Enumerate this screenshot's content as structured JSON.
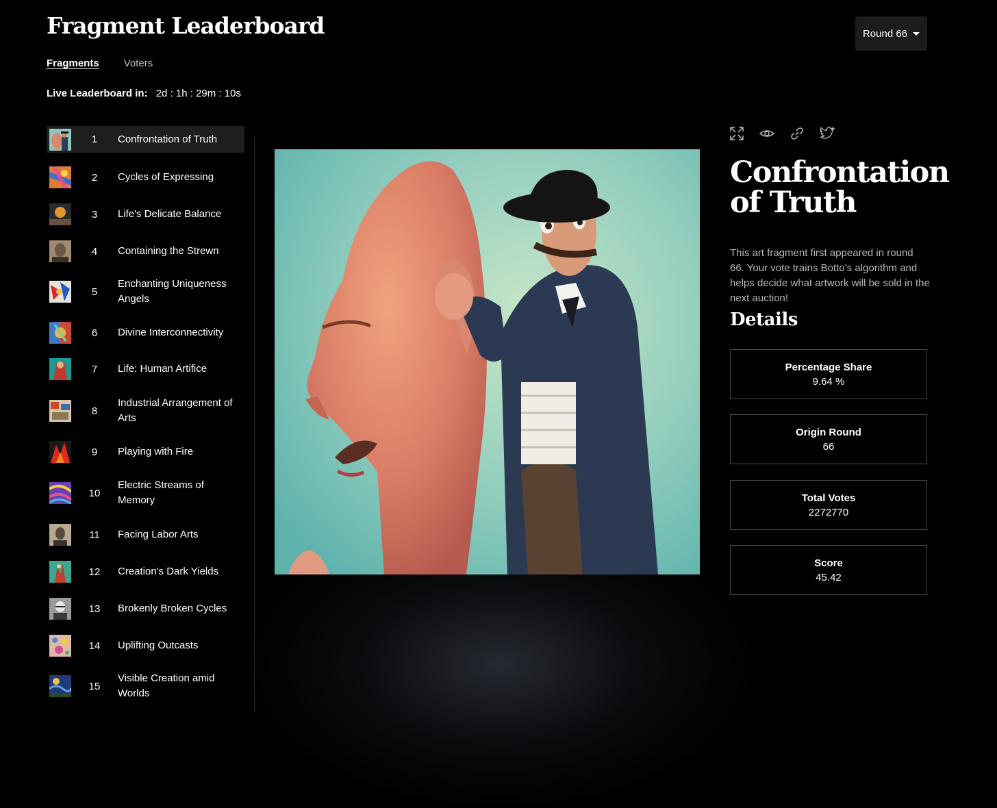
{
  "header": {
    "title": "Fragment Leaderboard",
    "round_label": "Round 66"
  },
  "tabs": [
    {
      "label": "Fragments",
      "active": true
    },
    {
      "label": "Voters",
      "active": false
    }
  ],
  "live": {
    "label": "Live Leaderboard in:",
    "countdown": "2d : 1h : 29m : 10s"
  },
  "leaderboard": [
    {
      "rank": "1",
      "name": "Confrontation of Truth",
      "active": true
    },
    {
      "rank": "2",
      "name": "Cycles of Expressing"
    },
    {
      "rank": "3",
      "name": "Life's Delicate Balance"
    },
    {
      "rank": "4",
      "name": "Containing the Strewn"
    },
    {
      "rank": "5",
      "name": "Enchanting Uniqueness Angels"
    },
    {
      "rank": "6",
      "name": "Divine Interconnectivity"
    },
    {
      "rank": "7",
      "name": "Life: Human Artifice"
    },
    {
      "rank": "8",
      "name": "Industrial Arrangement of Arts"
    },
    {
      "rank": "9",
      "name": "Playing with Fire"
    },
    {
      "rank": "10",
      "name": "Electric Streams of Memory"
    },
    {
      "rank": "11",
      "name": "Facing Labor Arts"
    },
    {
      "rank": "12",
      "name": "Creation's Dark Yields"
    },
    {
      "rank": "13",
      "name": "Brokenly Broken Cycles"
    },
    {
      "rank": "14",
      "name": "Uplifting Outcasts"
    },
    {
      "rank": "15",
      "name": "Visible Creation amid Worlds"
    }
  ],
  "icons": [
    "expand-icon",
    "eye-icon",
    "link-icon",
    "twitter-icon"
  ],
  "fragment": {
    "title": "Confrontation of Truth",
    "description": "This art fragment first appeared in round 66. Your vote trains Botto’s algorithm and helps decide what artwork will be sold in the next auction!",
    "details_heading": "Details"
  },
  "details": [
    {
      "label": "Percentage Share",
      "value": "9.64 %"
    },
    {
      "label": "Origin Round",
      "value": "66"
    },
    {
      "label": "Total Votes",
      "value": "2272770"
    },
    {
      "label": "Score",
      "value": "45.42"
    }
  ],
  "colors": {
    "background": "#000000",
    "active_row": "#1e1e1e",
    "muted_text": "#b9b9b9",
    "card_border": "#4a4a4a"
  }
}
